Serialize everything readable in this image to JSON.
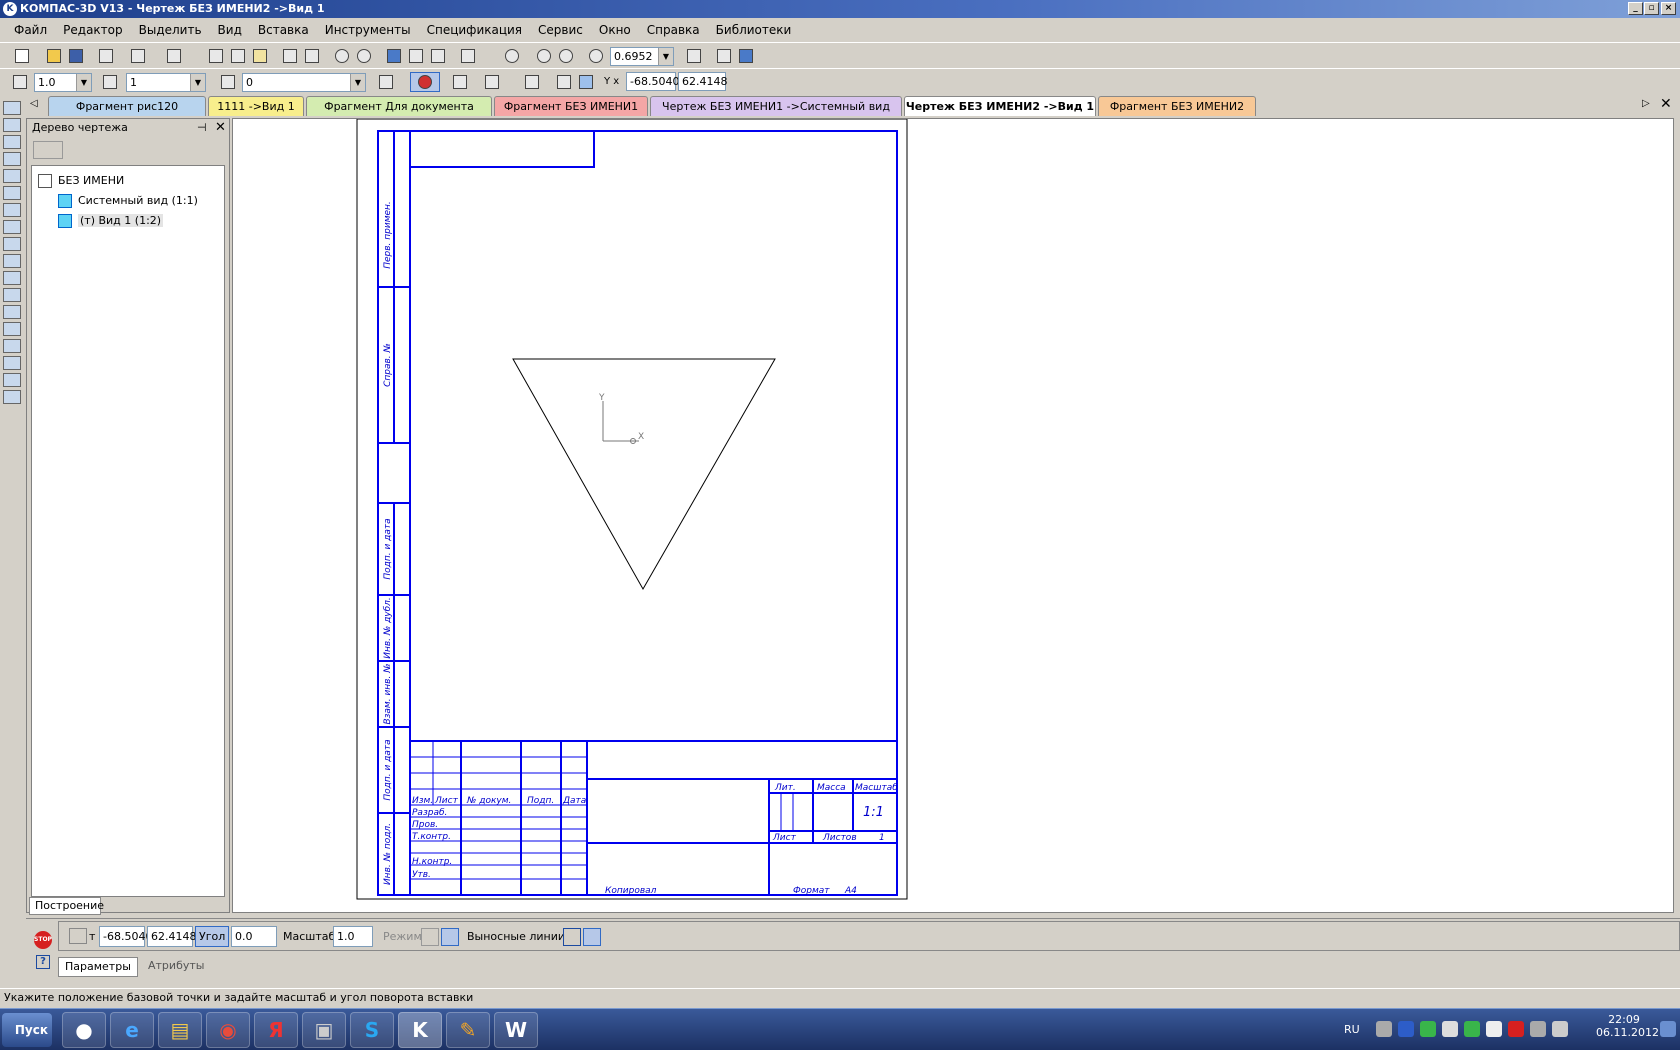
{
  "window": {
    "title": "КОМПАС-3D V13 - Чертеж БЕЗ ИМЕНИ2 ->Вид 1"
  },
  "menu": [
    "Файл",
    "Редактор",
    "Выделить",
    "Вид",
    "Вставка",
    "Инструменты",
    "Спецификация",
    "Сервис",
    "Окно",
    "Справка",
    "Библиотеки"
  ],
  "toolbar1": {
    "zoom_value": "0.6952"
  },
  "toolbar2": {
    "style_value": "1.0",
    "view_value": "1",
    "layer_value": "0",
    "coord_x": "-68.5040",
    "coord_y": "62.4148"
  },
  "tabs": [
    {
      "label": "Фрагмент рис120",
      "color": "#b8d4ee"
    },
    {
      "label": "1111 ->Вид 1",
      "color": "#f8ee8c"
    },
    {
      "label": "Фрагмент Для документа",
      "color": "#d4ecb0"
    },
    {
      "label": "Фрагмент БЕЗ ИМЕНИ1",
      "color": "#f4a6a6"
    },
    {
      "label": "Чертеж БЕЗ ИМЕНИ1 ->Системный вид",
      "color": "#d8c4ee"
    },
    {
      "label": "Чертеж БЕЗ ИМЕНИ2 ->Вид 1",
      "color": "#bfe6df"
    },
    {
      "label": "Фрагмент БЕЗ ИМЕНИ2",
      "color": "#f8c896"
    }
  ],
  "tree": {
    "title": "Дерево чертежа",
    "root": "БЕЗ ИМЕНИ",
    "items": [
      "Системный вид (1:1)",
      "(т) Вид 1 (1:2)"
    ],
    "bottom_tab": "Построение"
  },
  "drawing": {
    "side_labels": [
      "Перв. примен.",
      "Справ. №",
      "Подп. и дата",
      "Инв. № дубл.",
      "Взам. инв. №",
      "Подп. и дата",
      "Инв. № подл."
    ],
    "stamp_headers": [
      "Изм.",
      "Лист",
      "№ докум.",
      "Подп.",
      "Дата"
    ],
    "stamp_rows": [
      "Разраб.",
      "Пров.",
      "Т.контр.",
      "",
      "Н.контр.",
      "Утв."
    ],
    "lit": "Лит.",
    "mass": "Масса",
    "scale_label": "Масштаб",
    "scale_value": "1:1",
    "sheet": "Лист",
    "sheets": "Листов",
    "sheets_value": "1",
    "copied": "Копировал",
    "format": "Формат",
    "format_value": "А4",
    "axis_x": "X",
    "axis_y": "Y"
  },
  "params": {
    "point_label": "т",
    "x": "-68.5040",
    "y": "62.4148",
    "angle_label": "Угол",
    "angle": "0.0",
    "scale_label": "Масштаб",
    "scale": "1.0",
    "mode_label": "Режим",
    "lines_label": "Выносные линии",
    "tab_params": "Параметры",
    "tab_attrs": "Атрибуты",
    "stop": "STOP",
    "help": "?"
  },
  "status": {
    "hint": "Укажите положение базовой точки и задайте масштаб и угол поворота вставки"
  },
  "taskbar": {
    "start": "Пуск",
    "lang": "RU",
    "time": "22:09",
    "date": "06.11.2012"
  },
  "icons": [
    "new-icon",
    "open-icon",
    "save-icon",
    "print-icon",
    "preview-icon",
    "cut-icon",
    "copy-icon",
    "paste-icon",
    "undo-icon",
    "redo-icon",
    "zoom-icon",
    "pan-icon",
    "snap-icon",
    "grid-icon",
    "ortho-icon"
  ]
}
